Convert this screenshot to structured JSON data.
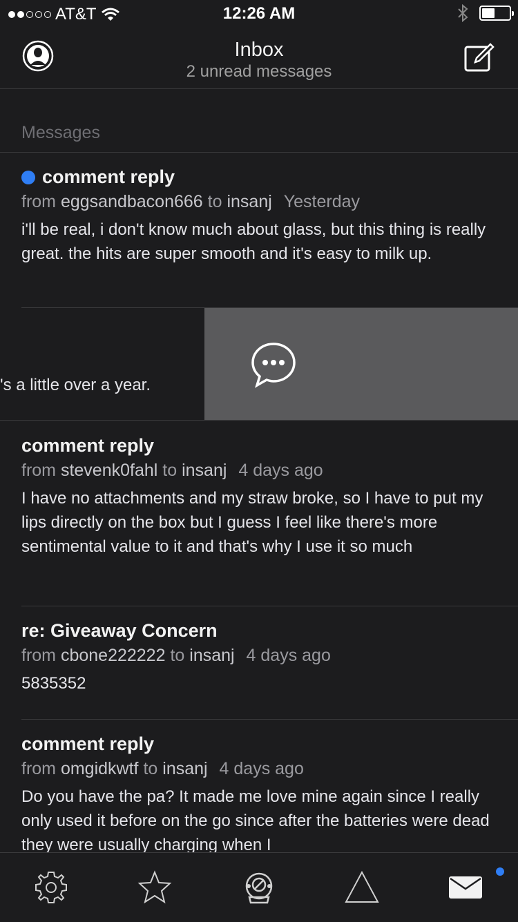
{
  "status_bar": {
    "carrier": "AT&T",
    "time": "12:26 AM"
  },
  "header": {
    "title": "Inbox",
    "subtitle": "2 unread messages"
  },
  "section_label": "Messages",
  "messages": [
    {
      "subject": "comment reply",
      "from_word": "from",
      "sender": "eggsandbacon666",
      "to_word": "to",
      "recipient": "insanj",
      "when": "Yesterday",
      "body": "i'll be real, i don't know much about glass, but this thing is really great. the hits are super smooth and it's easy to milk up.",
      "unread": true
    },
    {
      "subject": "comment reply",
      "from_word": "from",
      "sender": "stevenk0fahl",
      "to_word": "to",
      "recipient": "insanj",
      "when": "4 days ago",
      "body": "I have no attachments and my straw broke, so I have to put my lips directly on the box but I guess I feel like there's more sentimental value to it and that's why I use it so much",
      "unread": false
    },
    {
      "subject": "re: Giveaway Concern",
      "from_word": "from",
      "sender": "cbone222222",
      "to_word": "to",
      "recipient": "insanj",
      "when": "4 days ago",
      "body": "5835352",
      "unread": false
    },
    {
      "subject": "comment reply",
      "from_word": "from",
      "sender": "omgidkwtf",
      "to_word": "to",
      "recipient": "insanj",
      "when": "4 days ago",
      "body": "Do you have the pa? It made me love mine again since I really only used it before on the go since after the batteries were dead they were usually charging when I",
      "unread": false
    }
  ],
  "swiped_row": {
    "visible_text": "'s a little over a year.",
    "action_icon": "reply-bubble-icon"
  },
  "tabs": [
    {
      "icon": "gear-icon"
    },
    {
      "icon": "star-icon"
    },
    {
      "icon": "diver-helmet-icon"
    },
    {
      "icon": "triangle-icon"
    },
    {
      "icon": "mail-icon",
      "badge": true
    }
  ],
  "colors": {
    "background": "#1c1c1e",
    "accent": "#2f7ef5",
    "swipe_action": "#5a5a5c"
  }
}
